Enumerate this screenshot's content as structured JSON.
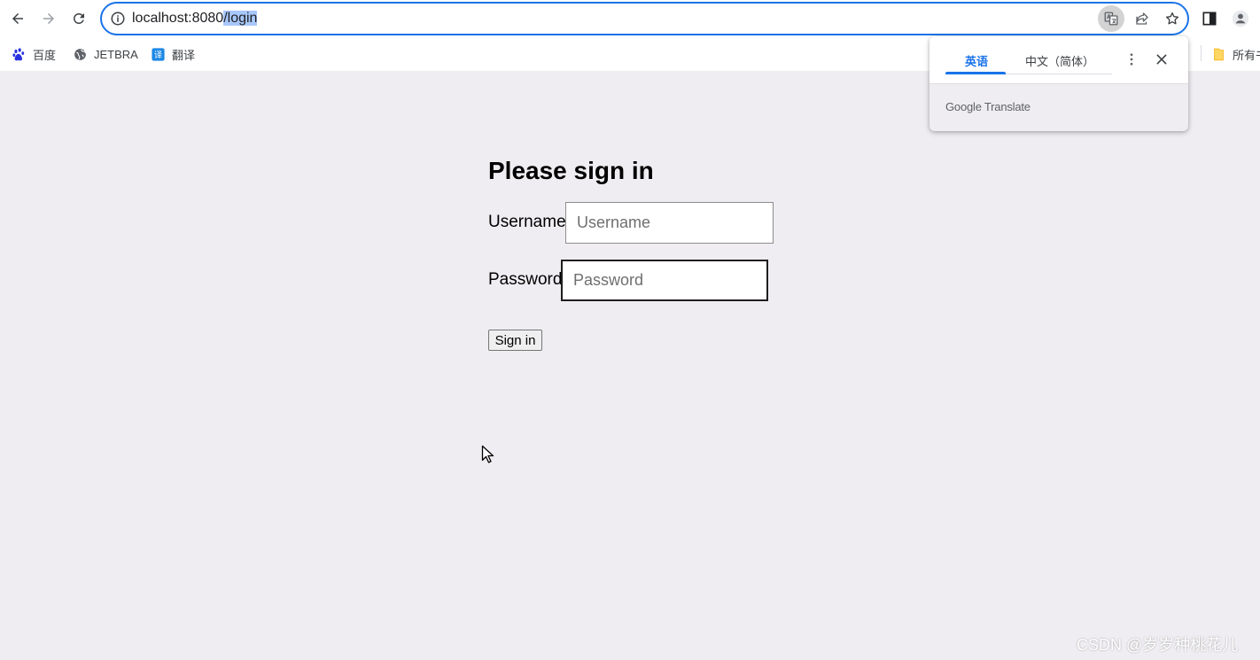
{
  "browser": {
    "url_host": "localhost:8080",
    "url_path": "/login",
    "bookmarks": [
      {
        "label": "百度",
        "icon": "baidu-paw-icon"
      },
      {
        "label": "JETBRA",
        "icon": "globe-icon"
      },
      {
        "label": "翻译",
        "icon": "translate-app-icon"
      },
      {
        "label": "所有书签",
        "icon": "folder-icon"
      }
    ],
    "accent_color": "#1a73e8"
  },
  "translate_popup": {
    "tab_source": "英语",
    "tab_target": "中文（简体）",
    "footer_google": "Google",
    "footer_translate": " Translate"
  },
  "login": {
    "heading": "Please sign in",
    "username_label": "Username",
    "username_placeholder": "Username",
    "password_label": "Password",
    "password_placeholder": "Password",
    "submit_label": "Sign in"
  },
  "watermark": "CSDN @岁岁种桃花儿"
}
